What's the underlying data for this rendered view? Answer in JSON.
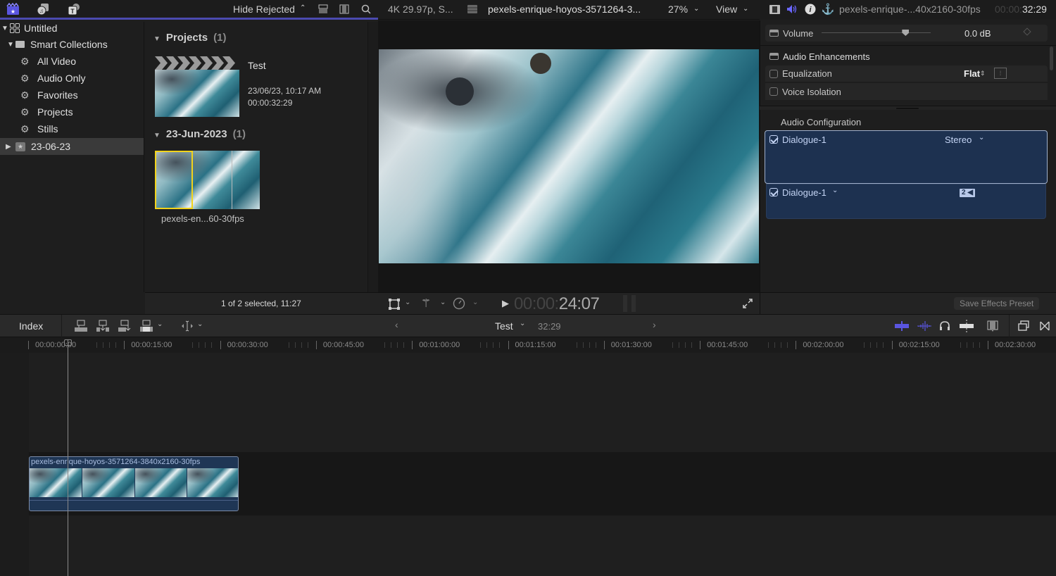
{
  "toolbar_left": {
    "icons": [
      "libraries-icon",
      "photos-audio-icon",
      "titles-generators-icon"
    ],
    "filter_label": "Hide Rejected",
    "view_icons": [
      "clip-appearance-icon",
      "filmstrip-icon",
      "search-icon"
    ]
  },
  "toolbar_center": {
    "format": "4K 29.97p, S...",
    "clip_name": "pexels-enrique-hoyos-3571264-3...",
    "zoom": "27%",
    "view_label": "View"
  },
  "toolbar_right": {
    "clip_name": "pexels-enrique-...40x2160-30fps",
    "timecode_dim": "00:00:",
    "timecode": "32:29"
  },
  "sidebar": {
    "library": "Untitled",
    "smart_collections": "Smart Collections",
    "items": [
      {
        "label": "All Video"
      },
      {
        "label": "Audio Only"
      },
      {
        "label": "Favorites"
      },
      {
        "label": "Projects"
      },
      {
        "label": "Stills"
      }
    ],
    "event": "23-06-23"
  },
  "browser": {
    "projects_group": {
      "title": "Projects",
      "count": "(1)"
    },
    "project": {
      "name": "Test",
      "date": "23/06/23, 10:17 AM",
      "duration": "00:00:32:29"
    },
    "event_group": {
      "title": "23-Jun-2023",
      "count": "(1)"
    },
    "clip": {
      "name": "pexels-en...60-30fps"
    },
    "status": "1 of 2 selected, 11:27"
  },
  "viewer": {
    "timecode_dim": "00:00:",
    "timecode": "24:07"
  },
  "inspector": {
    "volume_label": "Volume",
    "volume_value": "0.0 dB",
    "volume_level": 0.77,
    "audio_enhancements": "Audio Enhancements",
    "equalization": "Equalization",
    "eq_preset": "Flat",
    "voice_isolation": "Voice Isolation",
    "audio_configuration": "Audio Configuration",
    "config_rows": [
      {
        "label": "Dialogue-1",
        "value": "Stereo",
        "checked": true
      },
      {
        "label": "Dialogue-1",
        "value": "2",
        "checked": true
      }
    ],
    "save_preset": "Save Effects Preset"
  },
  "timeline": {
    "index_label": "Index",
    "project_name": "Test",
    "project_duration": "32:29",
    "ruler": [
      "00:00:00:00",
      "00:00:15:00",
      "00:00:30:00",
      "00:00:45:00",
      "00:01:00:00",
      "00:01:15:00",
      "00:01:30:00",
      "00:01:45:00",
      "00:02:00:00",
      "00:02:15:00",
      "00:02:30:00"
    ],
    "clip_name": "pexels-enrique-hoyos-3571264-3840x2160-30fps"
  },
  "colors": {
    "accent": "#4b4ab0",
    "selection_yellow": "#f2d31b",
    "clip_blue": "#1f3655",
    "audio_config_blue": "#1d3150"
  }
}
